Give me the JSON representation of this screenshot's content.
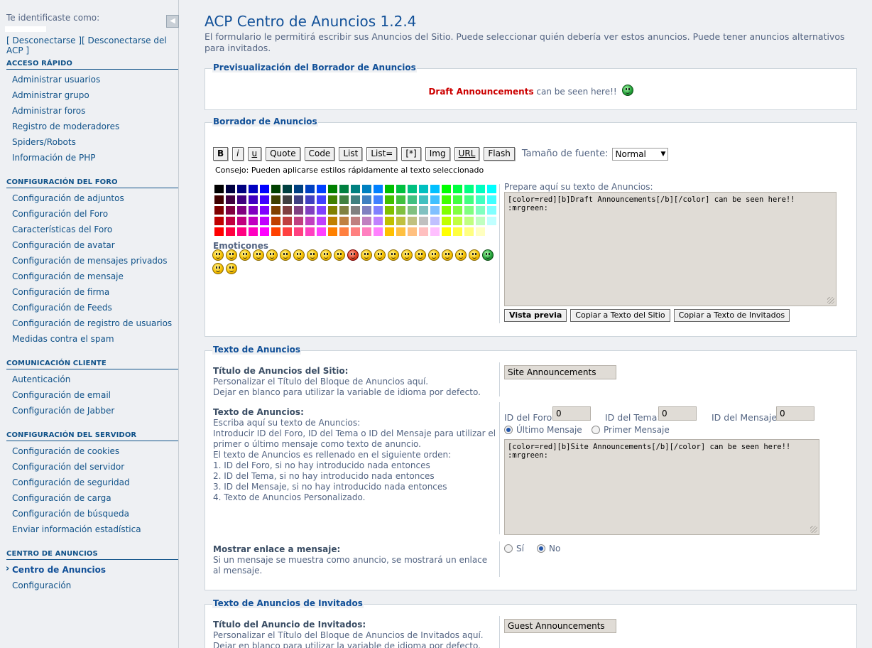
{
  "sidebar": {
    "logged_in_as": "Te identificaste como:",
    "logout_links": "[ Desconectarse ][ Desconectarse del ACP ]",
    "sections": [
      {
        "title": "ACCESO RÁPIDO",
        "items": [
          "Administrar usuarios",
          "Administrar grupo",
          "Administrar foros",
          "Registro de moderadores",
          "Spiders/Robots",
          "Información de PHP"
        ]
      },
      {
        "title": "CONFIGURACIÓN DEL FORO",
        "items": [
          "Configuración de adjuntos",
          "Configuración del Foro",
          "Características del Foro",
          "Configuración de avatar",
          "Configuración de mensajes privados",
          "Configuración de mensaje",
          "Configuración de firma",
          "Configuración de Feeds",
          "Configuración de registro de usuarios",
          "Medidas contra el spam"
        ]
      },
      {
        "title": "COMUNICACIÓN CLIENTE",
        "items": [
          "Autenticación",
          "Configuración de email",
          "Configuración de Jabber"
        ]
      },
      {
        "title": "CONFIGURACIÓN DEL SERVIDOR",
        "items": [
          "Configuración de cookies",
          "Configuración del servidor",
          "Configuración de seguridad",
          "Configuración de carga",
          "Configuración de búsqueda",
          "Enviar información estadística"
        ]
      },
      {
        "title": "CENTRO DE ANUNCIOS",
        "items": [
          "Centro de Anuncios",
          "Configuración"
        ],
        "active_index": 0
      }
    ]
  },
  "page": {
    "title": "ACP Centro de Anuncios 1.2.4",
    "intro": "El formulario le permitirá escribir sus Anuncios del Sitio. Puede seleccionar quién debería ver estos anuncios. Puede tener anuncios alternativos para invitados."
  },
  "preview": {
    "legend": "Previsualización del Borrador de Anuncios",
    "red_text": "Draft Announcements",
    "rest_text": " can be seen here!!"
  },
  "draft": {
    "legend": "Borrador de Anuncios",
    "format_buttons": [
      "B",
      "i",
      "u",
      "Quote",
      "Code",
      "List",
      "List=",
      "[*]",
      "Img",
      "URL",
      "Flash"
    ],
    "font_size_label": "Tamaño de fuente:",
    "font_size_value": "Normal",
    "tip": "Consejo: Pueden aplicarse estilos rápidamente al texto seleccionado",
    "emoticons_title": "Emoticones",
    "prepare_label": "Prepare aquí su texto de Anuncios:",
    "textarea_value": "[color=red][b]Draft Announcements[/b][/color] can be seen here!! :mrgreen:",
    "action_buttons": [
      "Vista previa",
      "Copiar a Texto del Sitio",
      "Copiar a Texto de Invitados"
    ]
  },
  "site_text": {
    "legend": "Texto de Anuncios",
    "title_label": "Título de Anuncios del Sitio:",
    "title_help_1": "Personalizar el Título del Bloque de Anuncios aquí.",
    "title_help_2": "Dejar en blanco para utilizar la variable de idioma por defecto.",
    "title_value": "Site Announcements",
    "text_label": "Texto de Anuncios:",
    "text_help": [
      "Escriba aquí su texto de Anuncios:",
      "Introducir ID del Foro, ID del Tema o ID del Mensaje para utilizar el",
      "primer o último mensaje como texto de anuncio.",
      "El texto de Anuncios es rellenado en el siguiente orden:",
      "1. ID del Foro, si no hay introducido nada entonces",
      "2. ID del Tema, si no hay introducido nada entonces",
      "3. ID del Mensaje, si no hay introducido nada entonces",
      "4. Texto de Anuncios Personalizado."
    ],
    "forum_id_label": "ID del Foro:",
    "forum_id": "0",
    "topic_id_label": "ID del Tema:",
    "topic_id": "0",
    "post_id_label": "ID del Mensaje:",
    "post_id": "0",
    "radio_last": "Último Mensaje",
    "radio_first": "Primer Mensaje",
    "textarea_value": "[color=red][b]Site Announcements[/b][/color] can be seen here!! :mrgreen:",
    "show_link_label": "Mostrar enlace a mensaje:",
    "show_link_help": "Si un mensaje se muestra como anuncio, se mostrará un enlace al mensaje.",
    "yes": "Sí",
    "no": "No"
  },
  "guest_text": {
    "legend": "Texto de Anuncios de Invitados",
    "title_label": "Título del Anuncio de Invitados:",
    "title_help_1": "Personalizar el Título del Bloque de Anuncios de Invitados aquí.",
    "title_help_2": "Dejar en blanco para utilizar la variable de idioma por defecto.",
    "title_value": "Guest Announcements"
  },
  "colors": {
    "accent": "#105289",
    "title": "#115098",
    "text": "#536482",
    "draft_red": "#cc0000"
  }
}
